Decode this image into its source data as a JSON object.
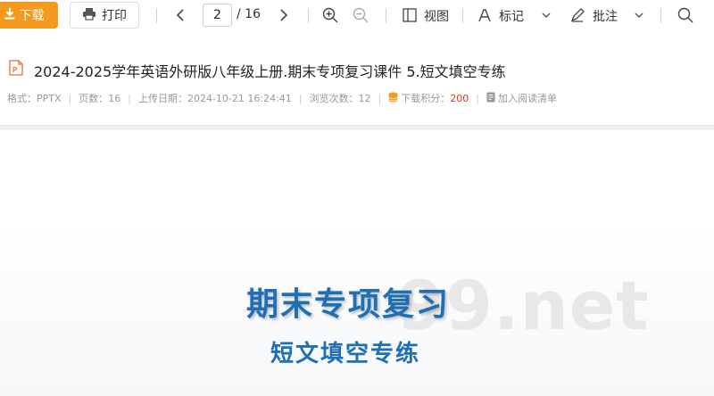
{
  "toolbar": {
    "download_label": "下载",
    "print_label": "打印",
    "current_page": "2",
    "total_pages": "/ 16",
    "view_label": "视图",
    "mark_label": "标记",
    "annotate_label": "批注"
  },
  "document": {
    "title": "2024-2025学年英语外研版八年级上册.期末专项复习课件 5.短文填空专练",
    "meta": {
      "format": "格式：PPTX",
      "pages": "页数：16",
      "upload_date": "上传日期：2024-10-21 16:24:41",
      "views": "浏览次数：12",
      "points_label": "下载积分：",
      "points_value": "200",
      "add_list": "加入阅读清单"
    }
  },
  "slide": {
    "title": "期末专项复习",
    "subtitle": "短文填空专练",
    "watermark": "99.net"
  },
  "colors": {
    "accent": "#f39a1f",
    "slide_text": "#1f6fb5",
    "points": "#e5352b"
  }
}
